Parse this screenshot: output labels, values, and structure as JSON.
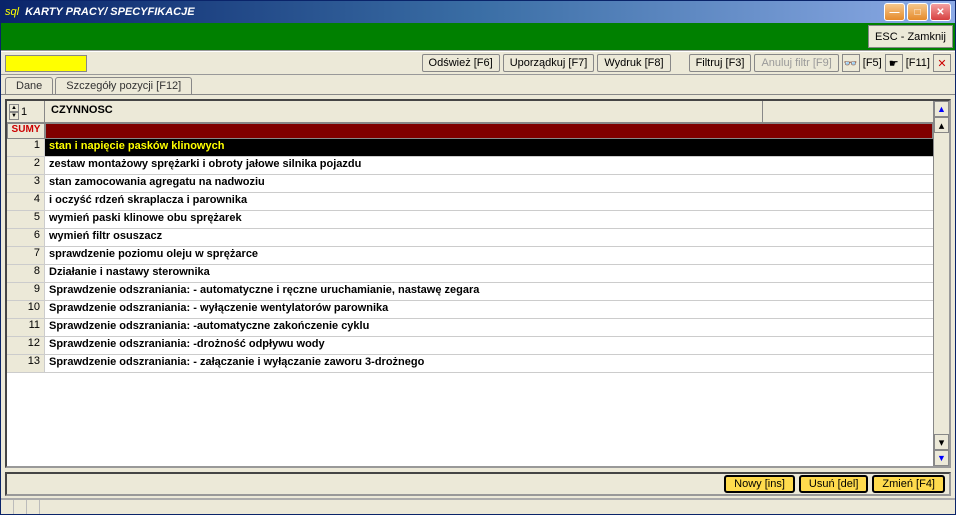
{
  "window": {
    "prefix": "sql",
    "title": "KARTY PRACY/ SPECYFIKACJE",
    "esc_label": "ESC - Zamknij"
  },
  "toolbar": {
    "refresh": "Odśwież [F6]",
    "sort": "Uporządkuj [F7]",
    "print": "Wydruk [F8]",
    "filter": "Filtruj [F3]",
    "cancel_filter": "Anuluj filtr [F9]",
    "f5": "[F5]",
    "f11": "[F11]"
  },
  "tabs": {
    "t1": "Dane",
    "t2": "Szczegóły pozycji [F12]"
  },
  "grid": {
    "spin_value": "1",
    "col1": "CZYNNOSC",
    "sumy": "SUMY",
    "rows": [
      {
        "n": "1",
        "v": "stan i napięcie pasków klinowych"
      },
      {
        "n": "2",
        "v": "zestaw montażowy sprężarki i obroty jałowe silnika pojazdu"
      },
      {
        "n": "3",
        "v": "stan zamocowania agregatu na nadwoziu"
      },
      {
        "n": "4",
        "v": "i oczyść rdzeń skraplacza i parownika"
      },
      {
        "n": "5",
        "v": "wymień paski klinowe obu sprężarek"
      },
      {
        "n": "6",
        "v": "wymień filtr osuszacz"
      },
      {
        "n": "7",
        "v": "sprawdzenie poziomu oleju w sprężarce"
      },
      {
        "n": "8",
        "v": "Działanie i nastawy sterownika"
      },
      {
        "n": "9",
        "v": "Sprawdzenie odszraniania: - automatyczne i ręczne uruchamianie, nastawę zegara"
      },
      {
        "n": "10",
        "v": "Sprawdzenie odszraniania: - wyłączenie wentylatorów parownika"
      },
      {
        "n": "11",
        "v": "Sprawdzenie odszraniania: -automatyczne zakończenie cyklu"
      },
      {
        "n": "12",
        "v": "Sprawdzenie odszraniania: -drożność odpływu wody"
      },
      {
        "n": "13",
        "v": "Sprawdzenie odszraniania: - załączanie i wyłączanie zaworu 3-drożnego"
      }
    ]
  },
  "footer": {
    "new": "Nowy [ins]",
    "delete": "Usuń [del]",
    "edit": "Zmień [F4]"
  },
  "status": {
    "s1": "",
    "s2": "",
    "s3": ""
  }
}
